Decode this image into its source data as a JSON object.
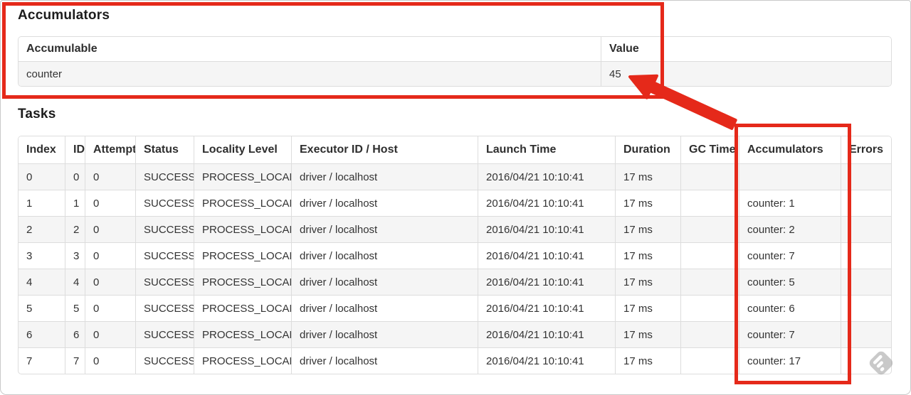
{
  "colors": {
    "annotation_red": "#e5291a",
    "row_stripe": "#f5f5f5",
    "table_border": "#dddddd"
  },
  "icons": {
    "sort_ascending": "▲"
  },
  "accumulators_section": {
    "title": "Accumulators",
    "columns": {
      "accumulable": "Accumulable",
      "value": "Value"
    },
    "rows": [
      {
        "accumulable": "counter",
        "value": "45"
      }
    ]
  },
  "tasks_section": {
    "title": "Tasks",
    "columns": {
      "index": "Index",
      "id": "ID",
      "attempt": "Attempt",
      "status": "Status",
      "locality": "Locality Level",
      "executor": "Executor ID / Host",
      "launch_time": "Launch Time",
      "duration": "Duration",
      "gc_time": "GC Time",
      "accumulators": "Accumulators",
      "errors": "Errors"
    },
    "rows": [
      {
        "index": "0",
        "id": "0",
        "attempt": "0",
        "status": "SUCCESS",
        "locality": "PROCESS_LOCAL",
        "executor": "driver / localhost",
        "launch_time": "2016/04/21 10:10:41",
        "duration": "17 ms",
        "gc_time": "",
        "accumulators": "",
        "errors": ""
      },
      {
        "index": "1",
        "id": "1",
        "attempt": "0",
        "status": "SUCCESS",
        "locality": "PROCESS_LOCAL",
        "executor": "driver / localhost",
        "launch_time": "2016/04/21 10:10:41",
        "duration": "17 ms",
        "gc_time": "",
        "accumulators": "counter: 1",
        "errors": ""
      },
      {
        "index": "2",
        "id": "2",
        "attempt": "0",
        "status": "SUCCESS",
        "locality": "PROCESS_LOCAL",
        "executor": "driver / localhost",
        "launch_time": "2016/04/21 10:10:41",
        "duration": "17 ms",
        "gc_time": "",
        "accumulators": "counter: 2",
        "errors": ""
      },
      {
        "index": "3",
        "id": "3",
        "attempt": "0",
        "status": "SUCCESS",
        "locality": "PROCESS_LOCAL",
        "executor": "driver / localhost",
        "launch_time": "2016/04/21 10:10:41",
        "duration": "17 ms",
        "gc_time": "",
        "accumulators": "counter: 7",
        "errors": ""
      },
      {
        "index": "4",
        "id": "4",
        "attempt": "0",
        "status": "SUCCESS",
        "locality": "PROCESS_LOCAL",
        "executor": "driver / localhost",
        "launch_time": "2016/04/21 10:10:41",
        "duration": "17 ms",
        "gc_time": "",
        "accumulators": "counter: 5",
        "errors": ""
      },
      {
        "index": "5",
        "id": "5",
        "attempt": "0",
        "status": "SUCCESS",
        "locality": "PROCESS_LOCAL",
        "executor": "driver / localhost",
        "launch_time": "2016/04/21 10:10:41",
        "duration": "17 ms",
        "gc_time": "",
        "accumulators": "counter: 6",
        "errors": ""
      },
      {
        "index": "6",
        "id": "6",
        "attempt": "0",
        "status": "SUCCESS",
        "locality": "PROCESS_LOCAL",
        "executor": "driver / localhost",
        "launch_time": "2016/04/21 10:10:41",
        "duration": "17 ms",
        "gc_time": "",
        "accumulators": "counter: 7",
        "errors": ""
      },
      {
        "index": "7",
        "id": "7",
        "attempt": "0",
        "status": "SUCCESS",
        "locality": "PROCESS_LOCAL",
        "executor": "driver / localhost",
        "launch_time": "2016/04/21 10:10:41",
        "duration": "17 ms",
        "gc_time": "",
        "accumulators": "counter: 17",
        "errors": ""
      }
    ]
  }
}
